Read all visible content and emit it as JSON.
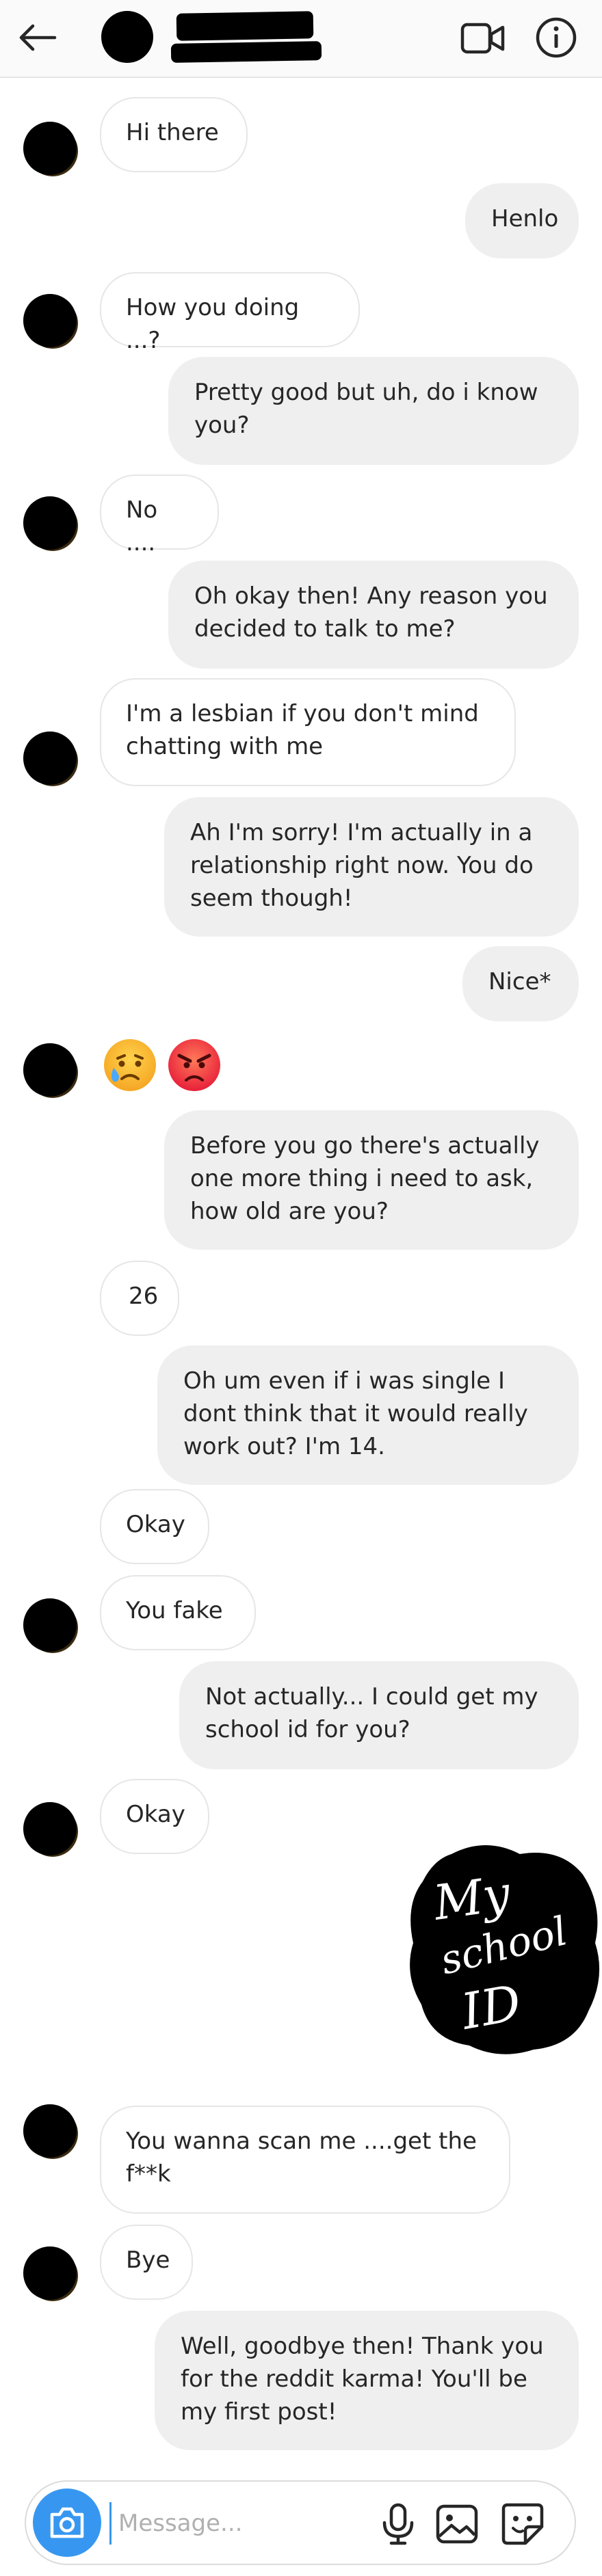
{
  "header": {
    "back_icon": "arrow-left-icon",
    "video_icon": "video-camera-icon",
    "info_icon": "info-icon"
  },
  "messages": [
    {
      "side": "in",
      "text": "Hi there"
    },
    {
      "side": "out",
      "text": "Henlo"
    },
    {
      "side": "in",
      "text": "How you doing ...?"
    },
    {
      "side": "out",
      "text": "Pretty good but uh, do i know\nyou?"
    },
    {
      "side": "in",
      "text": "No ...."
    },
    {
      "side": "out",
      "text": "Oh okay then! Any reason you\ndecided to talk to me?"
    },
    {
      "side": "in",
      "text": "I'm a lesbian if you don't mind\nchatting with me"
    },
    {
      "side": "out",
      "text": "Ah I'm sorry! I'm actually in a\nrelationship right now. You do\nseem though!"
    },
    {
      "side": "out",
      "text": "Nice*"
    },
    {
      "side": "in",
      "emojis": [
        "😥",
        "😡"
      ]
    },
    {
      "side": "out",
      "text": "Before you go there's actually\none more thing i need to ask,\nhow old are you?"
    },
    {
      "side": "in",
      "text": "26"
    },
    {
      "side": "out",
      "text": "Oh um even if i was single I\ndont think that it would really\nwork out? I'm 14."
    },
    {
      "side": "in",
      "text": "Okay"
    },
    {
      "side": "in",
      "text": "You fake"
    },
    {
      "side": "out",
      "text": "Not actually... I could get my\nschool id for you?"
    },
    {
      "side": "in",
      "text": "Okay"
    },
    {
      "side": "out",
      "sticker": [
        "My",
        "school",
        "ID"
      ]
    },
    {
      "side": "in",
      "text": "You wanna scan me ....get the\nf**k"
    },
    {
      "side": "in",
      "text": "Bye"
    },
    {
      "side": "out",
      "text": "Well, goodbye then! Thank you\nfor the reddit karma! You'll be\nmy first post!"
    }
  ],
  "composer": {
    "placeholder": "Message...",
    "camera_icon": "camera-icon",
    "mic_icon": "microphone-icon",
    "gallery_icon": "image-gallery-icon",
    "sticker_icon": "sticker-icon"
  },
  "colors": {
    "accent": "#3797f0",
    "outgoing_bubble": "#efefef",
    "incoming_border": "#e6e6e6"
  }
}
